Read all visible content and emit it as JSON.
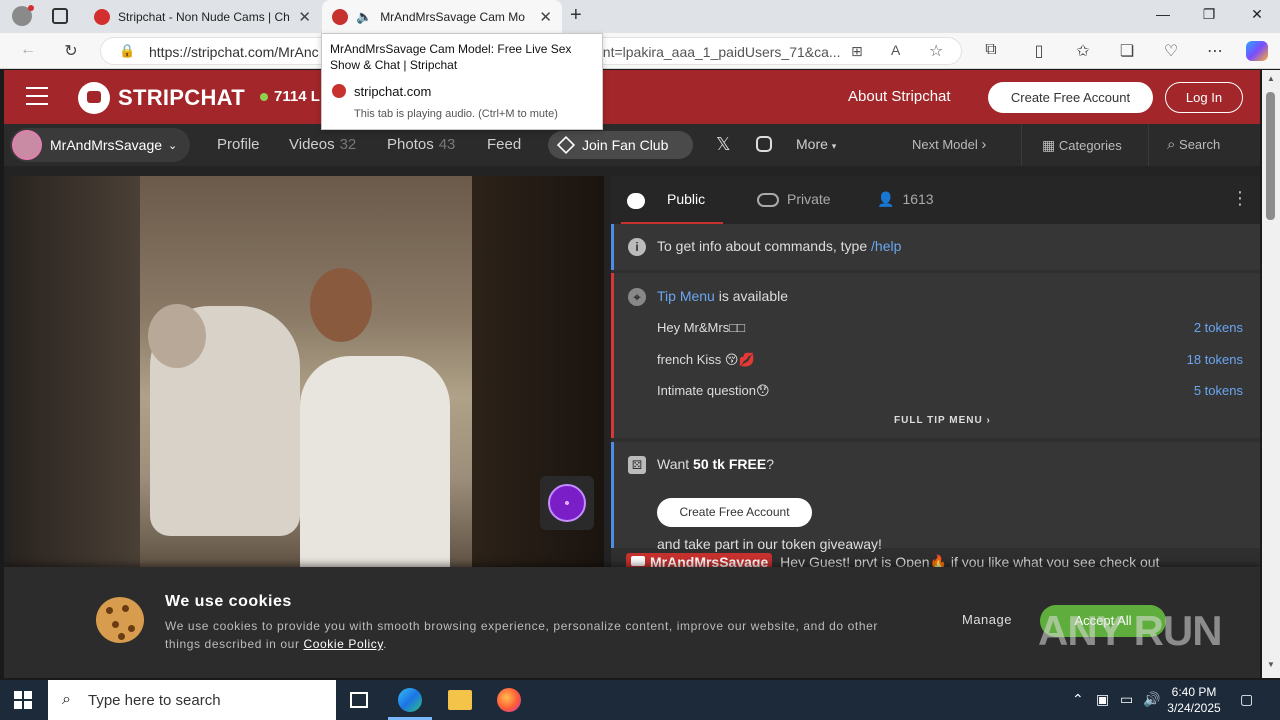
{
  "browser": {
    "tabs": [
      {
        "title": "Stripchat - Non Nude Cams | Ch"
      },
      {
        "title": "MrAndMrsSavage Cam Mo"
      }
    ],
    "url_main": "https://stripchat.com/MrAnc",
    "url_tail": "ant=lpakira_aaa_1_paidUsers_71&ca...",
    "tooltip": {
      "title": "MrAndMrsSavage Cam Model: Free Live Sex Show & Chat | Stripchat",
      "domain": "stripchat.com",
      "note": "This tab is playing audio. (Ctrl+M to mute)"
    }
  },
  "header": {
    "logo_text": "STRIPCHAT",
    "online_count": "7114",
    "online_suffix": "L",
    "about": "About Stripchat",
    "create_account": "Create Free Account",
    "login": "Log In"
  },
  "subnav": {
    "model_name": "MrAndMrsSavage",
    "profile": "Profile",
    "videos": "Videos",
    "videos_count": "32",
    "photos": "Photos",
    "photos_count": "43",
    "feed": "Feed",
    "fan_club": "Join Fan Club",
    "more": "More",
    "next_model": "Next Model",
    "categories": "Categories",
    "search": "Search"
  },
  "chat": {
    "tab_public": "Public",
    "tab_private": "Private",
    "viewer_count": "1613",
    "help_prefix": "To get info about commands, type ",
    "help_cmd": "/help",
    "tip_menu_link": "Tip Menu",
    "tip_menu_suffix": " is available",
    "tip_items": [
      {
        "label": "Hey Mr&Mrs□□",
        "price": "2 tokens"
      },
      {
        "label": "french Kiss 😚💋",
        "price": "18 tokens"
      },
      {
        "label": "Intimate question😯",
        "price": "5 tokens"
      }
    ],
    "full_tip_menu": "FULL TIP MENU",
    "free_prefix": "Want ",
    "free_bold": "50 tk FREE",
    "free_suffix": "?",
    "free_button": "Create Free Account",
    "giveaway": "and take part in our token giveaway!",
    "last_user": "MrAndMrsSavage",
    "last_text": "Hey Guest! prvt is Open🔥 if you like what you see check out"
  },
  "cookie": {
    "title": "We use cookies",
    "text": "We use cookies to provide you with smooth browsing experience, personalize content, improve our website, and do other things described in our ",
    "policy_link": "Cookie Policy",
    "period": ".",
    "manage": "Manage",
    "accept": "Accept All",
    "watermark": "ANY RUN"
  },
  "taskbar": {
    "search_placeholder": "Type here to search",
    "time": "6:40 PM",
    "date": "3/24/2025"
  },
  "colors": {
    "brand_red": "#a2262a",
    "accent_blue": "#4d8de6",
    "accept_green": "#5fae3d"
  }
}
